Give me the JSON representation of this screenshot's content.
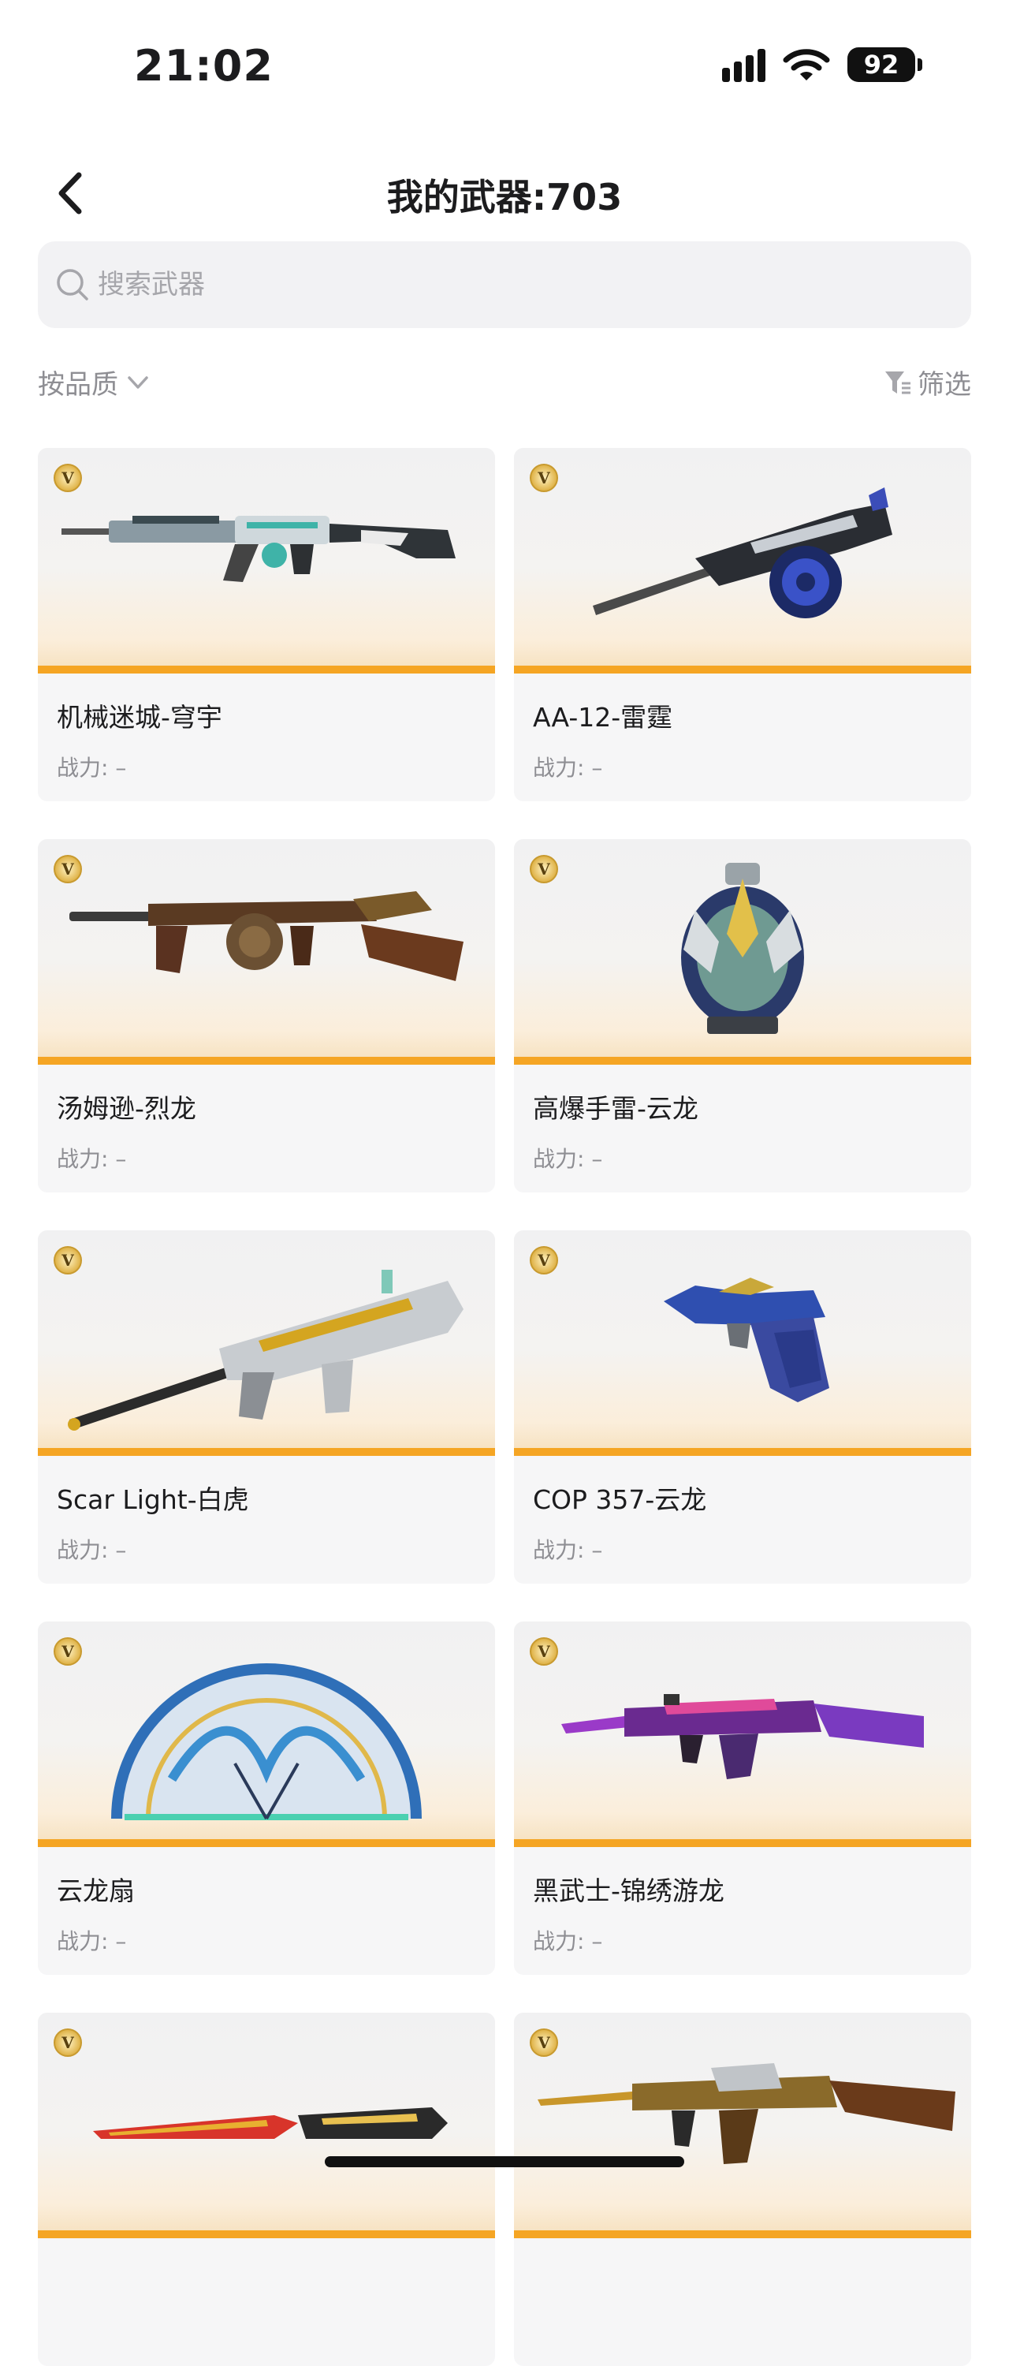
{
  "status_bar": {
    "time": "21:02",
    "battery": "92"
  },
  "header": {
    "title": "我的武器:703"
  },
  "search": {
    "placeholder": "搜索武器"
  },
  "filters": {
    "sort_label": "按品质",
    "filter_label": "筛选"
  },
  "cards": [
    {
      "name": "机械迷城-穹宇",
      "power_label": "战力: –",
      "badge": "V"
    },
    {
      "name": "AA-12-雷霆",
      "power_label": "战力: –",
      "badge": "V"
    },
    {
      "name": "汤姆逊-烈龙",
      "power_label": "战力: –",
      "badge": "V"
    },
    {
      "name": "高爆手雷-云龙",
      "power_label": "战力: –",
      "badge": "V"
    },
    {
      "name": "Scar Light-白虎",
      "power_label": "战力: –",
      "badge": "V"
    },
    {
      "name": "COP 357-云龙",
      "power_label": "战力: –",
      "badge": "V"
    },
    {
      "name": "云龙扇",
      "power_label": "战力: –",
      "badge": "V"
    },
    {
      "name": "黑武士-锦绣游龙",
      "power_label": "战力: –",
      "badge": "V"
    },
    {
      "name": "",
      "power_label": "",
      "badge": "V"
    },
    {
      "name": "",
      "power_label": "",
      "badge": "V"
    }
  ],
  "colors": {
    "rarity_bar": "#f5a524",
    "card_bg": "#f6f6f7",
    "muted_text": "#8e8e93"
  }
}
